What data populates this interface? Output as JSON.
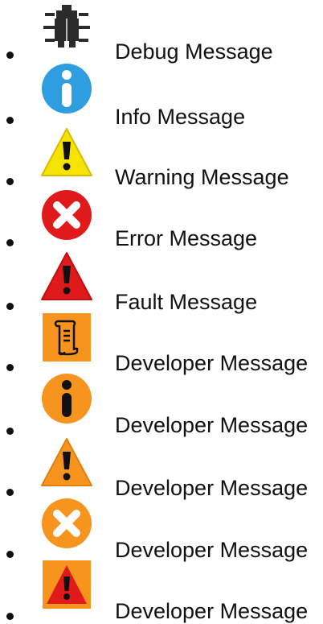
{
  "items": [
    {
      "label": "Debug Message",
      "icon": "bug-icon",
      "color": "#222222"
    },
    {
      "label": "Info Message",
      "icon": "info-icon",
      "color": "#2f9ee0"
    },
    {
      "label": "Warning Message",
      "icon": "warning-icon",
      "color": "#f5e300"
    },
    {
      "label": "Error Message",
      "icon": "error-icon",
      "color": "#e01a1a"
    },
    {
      "label": "Fault Message",
      "icon": "fault-icon",
      "color": "#e01a1a"
    },
    {
      "label": "Developer Message",
      "icon": "scroll-icon",
      "color": "#f7941d"
    },
    {
      "label": "Developer Message",
      "icon": "info-icon",
      "color": "#f7941d"
    },
    {
      "label": "Developer Message",
      "icon": "warning-icon",
      "color": "#f7941d"
    },
    {
      "label": "Developer Message",
      "icon": "error-icon",
      "color": "#f7941d"
    },
    {
      "label": "Developer Message",
      "icon": "fault-icon",
      "color": "#f7941d"
    }
  ]
}
